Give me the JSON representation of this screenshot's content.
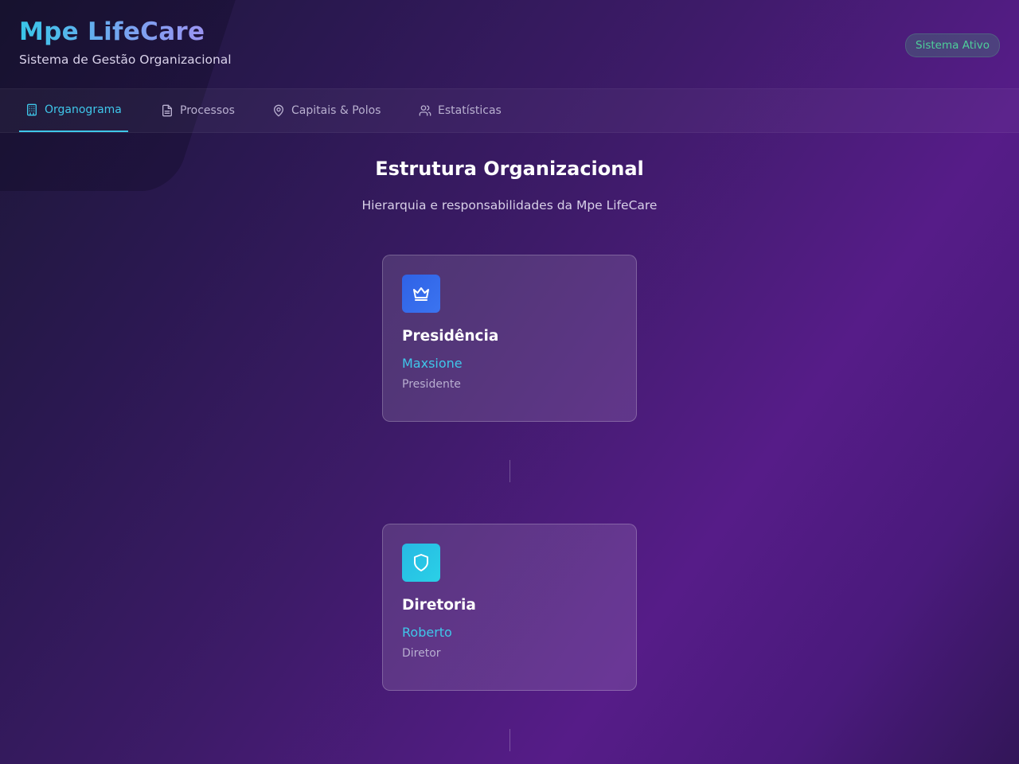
{
  "header": {
    "title": "Mpe LifeCare",
    "subtitle": "Sistema de Gestão Organizacional",
    "status": "Sistema Ativo"
  },
  "nav": {
    "tabs": [
      {
        "label": "Organograma",
        "icon": "building-icon",
        "active": true
      },
      {
        "label": "Processos",
        "icon": "document-icon",
        "active": false
      },
      {
        "label": "Capitais & Polos",
        "icon": "map-pin-icon",
        "active": false
      },
      {
        "label": "Estatísticas",
        "icon": "users-icon",
        "active": false
      }
    ]
  },
  "main": {
    "title": "Estrutura Organizacional",
    "subtitle": "Hierarquia e responsabilidades da Mpe LifeCare",
    "cards": [
      {
        "title": "Presidência",
        "person": "Maxsione",
        "role": "Presidente",
        "icon": "crown-icon",
        "color": "#2f62e6"
      },
      {
        "title": "Diretoria",
        "person": "Roberto",
        "role": "Diretor",
        "icon": "shield-icon",
        "color": "#27b9e4"
      }
    ]
  },
  "colors": {
    "accent": "#3fc7ea",
    "status": "#4ecf9a"
  }
}
